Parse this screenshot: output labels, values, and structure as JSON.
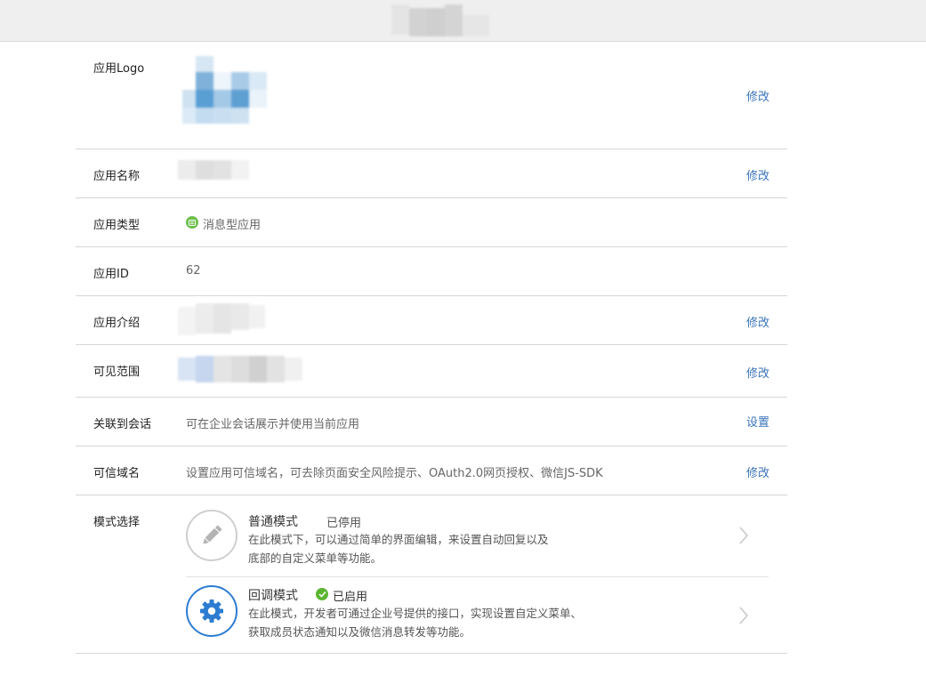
{
  "fields": {
    "logo": {
      "label": "应用Logo",
      "action": "修改"
    },
    "name": {
      "label": "应用名称",
      "action": "修改"
    },
    "type": {
      "label": "应用类型",
      "value": "消息型应用"
    },
    "id": {
      "label": "应用ID",
      "value": "62"
    },
    "intro": {
      "label": "应用介绍",
      "action": "修改"
    },
    "scope": {
      "label": "可见范围",
      "action": "修改"
    },
    "session": {
      "label": "关联到会话",
      "value": "可在企业会话展示并使用当前应用",
      "action": "设置"
    },
    "domain": {
      "label": "可信域名",
      "value": "设置应用可信域名，可去除页面安全风险提示、OAuth2.0网页授权、微信JS-SDK",
      "action": "修改"
    }
  },
  "modes": {
    "label": "模式选择",
    "normal": {
      "title": "普通模式",
      "status": "已停用",
      "desc1": "在此模式下，可以通过简单的界面编辑，来设置自动回复以及",
      "desc2": "底部的自定义菜单等功能。",
      "icon": "pencil-icon"
    },
    "callback": {
      "title": "回调模式",
      "status": "已启用",
      "desc1": "在此模式，开发者可通过企业号提供的接口，实现设置自定义菜单、",
      "desc2": "获取成员状态通知以及微信消息转发等功能。",
      "icon": "gear-icon"
    }
  },
  "colors": {
    "link": "#3a73b8",
    "enabled": "#5cb531",
    "gear_blue": "#2d7cd1"
  }
}
